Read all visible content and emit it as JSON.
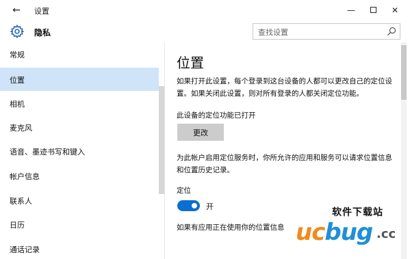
{
  "window": {
    "title": "设置",
    "back_glyph": "←",
    "minimize_glyph": "—",
    "close_glyph": "✕"
  },
  "header": {
    "title": "隐私",
    "icon": "gear-icon"
  },
  "search": {
    "placeholder": "查找设置",
    "icon": "search-icon"
  },
  "sidebar": {
    "items": [
      {
        "label": "常规"
      },
      {
        "label": "位置",
        "selected": true
      },
      {
        "label": "相机"
      },
      {
        "label": "麦克风"
      },
      {
        "label": "语音、墨迹书写和键入"
      },
      {
        "label": "帐户信息"
      },
      {
        "label": "联系人"
      },
      {
        "label": "日历"
      },
      {
        "label": "通话记录"
      }
    ]
  },
  "main": {
    "title": "位置",
    "description": "如果打开此设置，每个登录到这台设备的人都可以更改自己的定位设置。如果关闭此设置，则对所有登录的人都关闭定位功能。",
    "device_status": "此设备的定位功能已打开",
    "change_button": "更改",
    "service_description": "为此帐户启用定位服务时，你所允许的应用和服务可以请求位置信息和位置历史记录。",
    "location_label": "定位",
    "toggle": {
      "state_label": "开",
      "on": true
    },
    "truncated_text": "如果有应用正在使用你的位置信息"
  },
  "watermark": {
    "top_text": "软件下载站",
    "brand_part1": "uc",
    "brand_part2": "bug",
    "suffix": ".cc"
  },
  "colors": {
    "accent": "#0a6fd0",
    "selected_bg": "#cfe4f8",
    "button_bg": "#cccccc"
  }
}
